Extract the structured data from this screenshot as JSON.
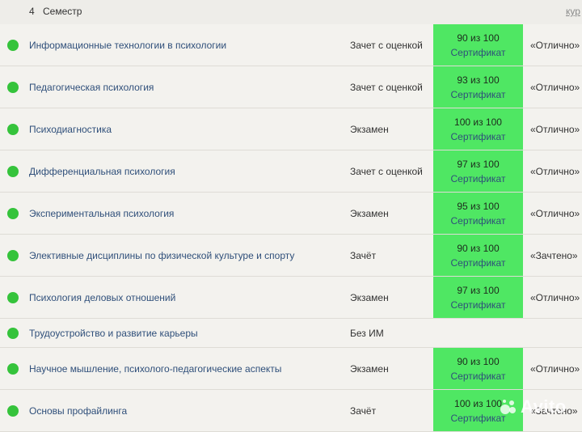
{
  "header": {
    "number": "4",
    "title": "Семестр",
    "link": "кур"
  },
  "rows": [
    {
      "subject": "Информационные технологии в психологии",
      "type": "Зачет с оценкой",
      "score": "90 из 100",
      "cert": "Сертификат",
      "result": "«Отлично»"
    },
    {
      "subject": "Педагогическая психология",
      "type": "Зачет с оценкой",
      "score": "93 из 100",
      "cert": "Сертификат",
      "result": "«Отлично»"
    },
    {
      "subject": "Психодиагностика",
      "type": "Экзамен",
      "score": "100 из 100",
      "cert": "Сертификат",
      "result": "«Отлично»"
    },
    {
      "subject": "Дифференциальная психология",
      "type": "Зачет с оценкой",
      "score": "97 из 100",
      "cert": "Сертификат",
      "result": "«Отлично»"
    },
    {
      "subject": "Экспериментальная психология",
      "type": "Экзамен",
      "score": "95 из 100",
      "cert": "Сертификат",
      "result": "«Отлично»"
    },
    {
      "subject": "Элективные дисциплины по физической культуре и спорту",
      "type": "Зачёт",
      "score": "90 из 100",
      "cert": "Сертификат",
      "result": "«Зачтено»"
    },
    {
      "subject": "Психология деловых отношений",
      "type": "Экзамен",
      "score": "97 из 100",
      "cert": "Сертификат",
      "result": "«Отлично»"
    },
    {
      "subject": "Трудоустройство и развитие карьеры",
      "type": "Без ИМ",
      "score": "",
      "cert": "",
      "result": ""
    },
    {
      "subject": "Научное мышление, психолого-педагогические аспекты",
      "type": "Экзамен",
      "score": "90 из 100",
      "cert": "Сертификат",
      "result": "«Отлично»"
    },
    {
      "subject": "Основы профайлинга",
      "type": "Зачёт",
      "score": "100 из 100",
      "cert": "Сертификат",
      "result": "«Зачтено»"
    }
  ],
  "watermark": "Avito",
  "colors": {
    "status_dot": "#35c33b",
    "grade_box": "#4fe763",
    "link": "#2f4f7a",
    "row_bg": "#f3f2ee"
  }
}
